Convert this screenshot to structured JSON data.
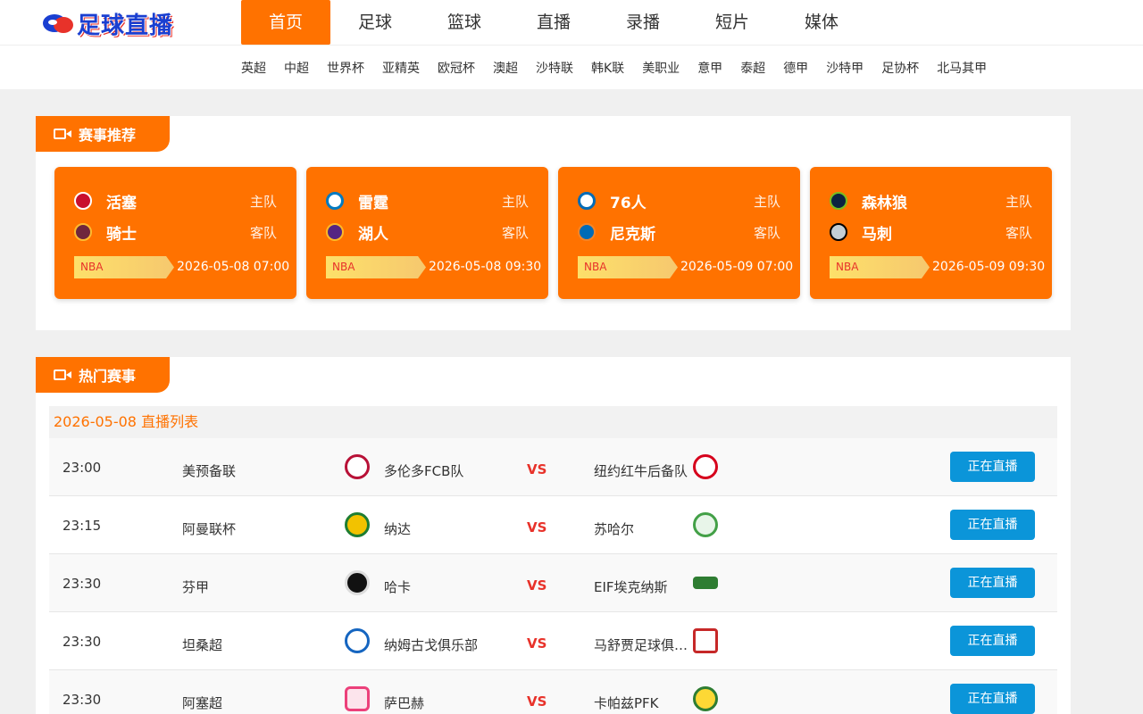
{
  "header": {
    "logo_text": "足球直播",
    "nav": [
      "首页",
      "足球",
      "篮球",
      "直播",
      "录播",
      "短片",
      "媒体"
    ],
    "active_nav": "首页",
    "subnav": [
      "英超",
      "中超",
      "世界杯",
      "亚精英",
      "欧冠杯",
      "澳超",
      "沙特联",
      "韩K联",
      "美职业",
      "意甲",
      "泰超",
      "德甲",
      "沙特甲",
      "足协杯",
      "北马其甲"
    ]
  },
  "colors": {
    "accent": "#ff7200",
    "live_button": "#0b95d9",
    "vs": "#e8322a"
  },
  "recommended": {
    "title": "赛事推荐",
    "cards": [
      {
        "home": "活塞",
        "away": "骑士",
        "home_role": "主队",
        "away_role": "客队",
        "league": "NBA",
        "time": "2026-05-08 07:00"
      },
      {
        "home": "雷霆",
        "away": "湖人",
        "home_role": "主队",
        "away_role": "客队",
        "league": "NBA",
        "time": "2026-05-08 09:30"
      },
      {
        "home": "76人",
        "away": "尼克斯",
        "home_role": "主队",
        "away_role": "客队",
        "league": "NBA",
        "time": "2026-05-09 07:00"
      },
      {
        "home": "森林狼",
        "away": "马刺",
        "home_role": "主队",
        "away_role": "客队",
        "league": "NBA",
        "time": "2026-05-09 09:30"
      }
    ]
  },
  "hot": {
    "title": "热门赛事",
    "date_label": "2026-05-08 直播列表",
    "vs_label": "VS",
    "matches": [
      {
        "time": "23:00",
        "league": "美预备联",
        "home": "多伦多FCB队",
        "away": "纽约红牛后备队",
        "status": "正在直播"
      },
      {
        "time": "23:15",
        "league": "阿曼联杯",
        "home": "纳达",
        "away": "苏哈尔",
        "status": "正在直播"
      },
      {
        "time": "23:30",
        "league": "芬甲",
        "home": "哈卡",
        "away": "EIF埃克纳斯",
        "status": "正在直播"
      },
      {
        "time": "23:30",
        "league": "坦桑超",
        "home": "纳姆古戈俱乐部",
        "away": "马舒贾足球俱乐部",
        "status": "正在直播"
      },
      {
        "time": "23:30",
        "league": "阿塞超",
        "home": "萨巴赫",
        "away": "卡帕兹PFK",
        "status": "正在直播"
      }
    ]
  }
}
